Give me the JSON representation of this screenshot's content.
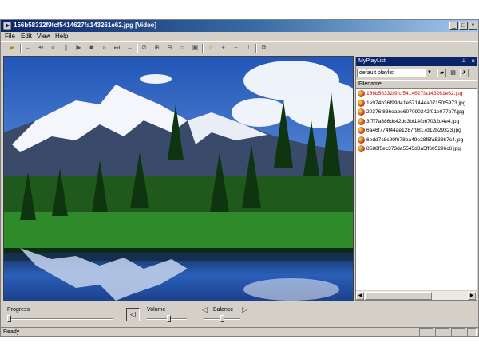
{
  "window": {
    "title": "156b58332f9fcf5414627fa143261e62.jpg [Video]",
    "controls": {
      "minimize": "_",
      "maximize": "□",
      "close": "×"
    }
  },
  "menu": [
    "File",
    "Edit",
    "View",
    "Help"
  ],
  "toolbar": {
    "icons": [
      "open-folder-icon",
      "prev-icon",
      "rewind-start-icon",
      "rewind-icon",
      "pause-icon",
      "play-icon",
      "stop-icon",
      "fast-forward-icon",
      "next-frame-icon",
      "next-icon",
      "zoom-fit-icon",
      "zoom-in-icon",
      "zoom-out-icon",
      "zoom-reset-icon",
      "fullscreen-icon",
      "info-icon",
      "add-icon",
      "remove-icon",
      "move-down-icon",
      "snapshot-icon"
    ]
  },
  "playlist": {
    "title": "MyPlayList",
    "selected": "default playlist",
    "column_header": "Filename",
    "items": [
      {
        "name": "156b58332f9fcf5414627fa143261e62.jpg",
        "active": true
      },
      {
        "name": "1e974b36f99d41e57144ea07150f5973.jpg",
        "active": false
      },
      {
        "name": "20376f836eabe607090242f01e077b7f.jpg",
        "active": false
      },
      {
        "name": "3f7f7a386dc42dc3bf14fb67032d4e4.jpg",
        "active": false
      },
      {
        "name": "6a46f774f44ae1287f9817d12b29323.jpg",
        "active": false
      },
      {
        "name": "6edd7c8c99f678ea49e28f5fa53367c4.jpg",
        "active": false
      },
      {
        "name": "8588f5ec373da5545d8a5ff605296c6.jpg",
        "active": false
      }
    ]
  },
  "controls": {
    "progress_label": "Progress",
    "volume_label": "Volume",
    "balance_label": "Balance",
    "progress_value": 0.0,
    "volume_value": 0.55,
    "balance_value": 0.5
  },
  "status": {
    "text": "Ready"
  },
  "colors": {
    "titlebar": "#0a246a",
    "face": "#d4d0c8",
    "active_item": "#d40000"
  }
}
